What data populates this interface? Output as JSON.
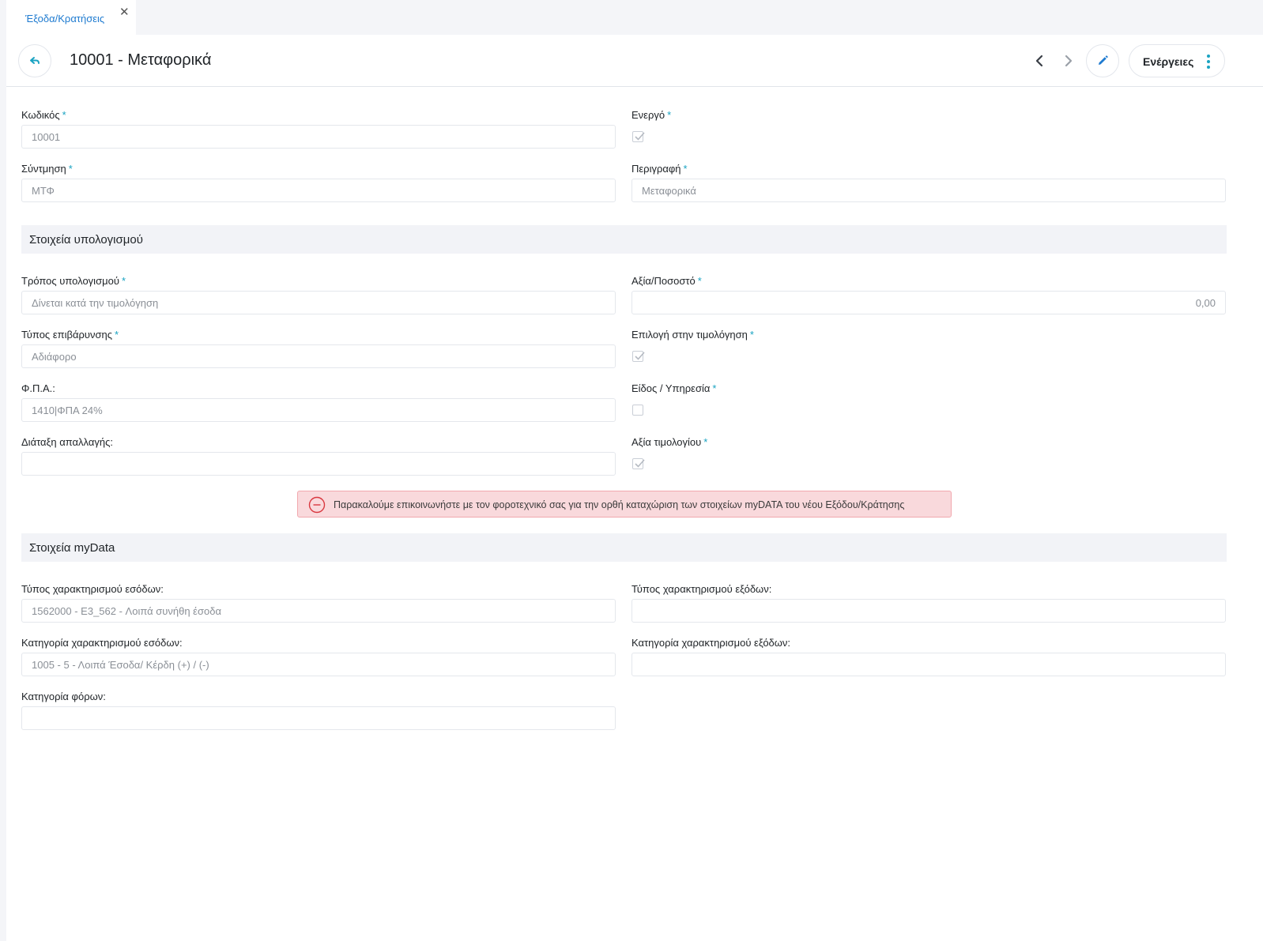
{
  "tab": {
    "label": "Έξοδα/Κρατήσεις",
    "close_icon": "close-icon"
  },
  "header": {
    "title": "10001 - Μεταφορικά",
    "actions_label": "Ενέργειες",
    "icons": [
      "back-icon",
      "chevron-left-icon",
      "chevron-right-icon",
      "pencil-icon",
      "more-vertical-icon"
    ]
  },
  "general": {
    "code": {
      "label": "Κωδικός",
      "value": "10001"
    },
    "active": {
      "label": "Ενεργό",
      "checked": true
    },
    "abbreviation": {
      "label": "Σύντμηση",
      "value": "ΜΤΦ"
    },
    "description": {
      "label": "Περιγραφή",
      "value": "Μεταφορικά"
    }
  },
  "calc": {
    "section_title": "Στοιχεία υπολογισμού",
    "calc_method": {
      "label": "Τρόπος υπολογισμού",
      "value": "Δίνεται κατά την τιμολόγηση"
    },
    "value_percent": {
      "label": "Αξία/Ποσοστό",
      "value": "0,00"
    },
    "charge_type": {
      "label": "Τύπος επιβάρυνσης",
      "value": "Αδιάφορο"
    },
    "invoice_selection": {
      "label": "Επιλογή στην τιμολόγηση",
      "checked": true
    },
    "vat": {
      "label": "Φ.Π.Α.:",
      "value": "1410|ΦΠΑ 24%"
    },
    "item_service": {
      "label": "Είδος / Υπηρεσία",
      "checked": false
    },
    "exemption": {
      "label": "Διάταξη απαλλαγής:",
      "value": ""
    },
    "invoice_value": {
      "label": "Αξία τιμολογίου",
      "checked": true
    }
  },
  "alert": {
    "icon": "minus-circle-icon",
    "text": "Παρακαλούμε επικοινωνήστε με τον φοροτεχνικό σας για την ορθή καταχώριση των στοιχείων myDATA του νέου Εξόδου/Κράτησης"
  },
  "mydata": {
    "section_title": "Στοιχεία myData",
    "income_char_type": {
      "label": "Τύπος χαρακτηρισμού εσόδων:",
      "value": "1562000 - E3_562 - Λοιπά συνήθη έσοδα"
    },
    "expense_char_type": {
      "label": "Τύπος χαρακτηρισμού εξόδων:",
      "value": ""
    },
    "income_char_category": {
      "label": "Κατηγορία χαρακτηρισμού εσόδων:",
      "value": "1005 - 5 - Λοιπά Έσοδα/ Κέρδη (+) / (-)"
    },
    "expense_char_category": {
      "label": "Κατηγορία χαρακτηρισμού εξόδων:",
      "value": ""
    },
    "tax_category": {
      "label": "Κατηγορία φόρων:",
      "value": ""
    }
  },
  "colors": {
    "accent": "#1aa3c2",
    "link": "#1f7bd0",
    "alert_bg": "#f9d9dc",
    "alert_border": "#f1a8ae",
    "alert_icon": "#d9383f"
  }
}
